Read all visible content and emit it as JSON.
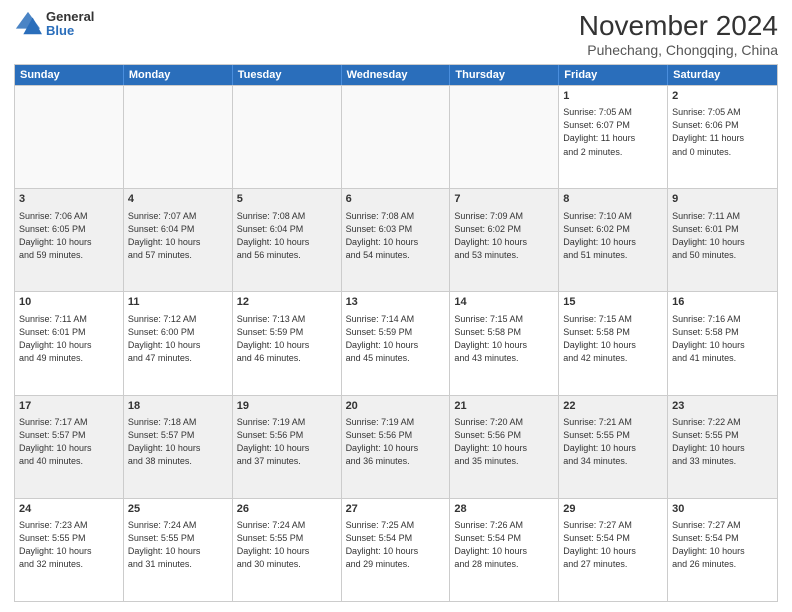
{
  "header": {
    "logo_general": "General",
    "logo_blue": "Blue",
    "month_title": "November 2024",
    "location": "Puhechang, Chongqing, China"
  },
  "weekdays": [
    "Sunday",
    "Monday",
    "Tuesday",
    "Wednesday",
    "Thursday",
    "Friday",
    "Saturday"
  ],
  "weeks": [
    [
      {
        "day": "",
        "info": "",
        "empty": true
      },
      {
        "day": "",
        "info": "",
        "empty": true
      },
      {
        "day": "",
        "info": "",
        "empty": true
      },
      {
        "day": "",
        "info": "",
        "empty": true
      },
      {
        "day": "",
        "info": "",
        "empty": true
      },
      {
        "day": "1",
        "info": "Sunrise: 7:05 AM\nSunset: 6:07 PM\nDaylight: 11 hours\nand 2 minutes.",
        "empty": false
      },
      {
        "day": "2",
        "info": "Sunrise: 7:05 AM\nSunset: 6:06 PM\nDaylight: 11 hours\nand 0 minutes.",
        "empty": false
      }
    ],
    [
      {
        "day": "3",
        "info": "Sunrise: 7:06 AM\nSunset: 6:05 PM\nDaylight: 10 hours\nand 59 minutes.",
        "empty": false
      },
      {
        "day": "4",
        "info": "Sunrise: 7:07 AM\nSunset: 6:04 PM\nDaylight: 10 hours\nand 57 minutes.",
        "empty": false
      },
      {
        "day": "5",
        "info": "Sunrise: 7:08 AM\nSunset: 6:04 PM\nDaylight: 10 hours\nand 56 minutes.",
        "empty": false
      },
      {
        "day": "6",
        "info": "Sunrise: 7:08 AM\nSunset: 6:03 PM\nDaylight: 10 hours\nand 54 minutes.",
        "empty": false
      },
      {
        "day": "7",
        "info": "Sunrise: 7:09 AM\nSunset: 6:02 PM\nDaylight: 10 hours\nand 53 minutes.",
        "empty": false
      },
      {
        "day": "8",
        "info": "Sunrise: 7:10 AM\nSunset: 6:02 PM\nDaylight: 10 hours\nand 51 minutes.",
        "empty": false
      },
      {
        "day": "9",
        "info": "Sunrise: 7:11 AM\nSunset: 6:01 PM\nDaylight: 10 hours\nand 50 minutes.",
        "empty": false
      }
    ],
    [
      {
        "day": "10",
        "info": "Sunrise: 7:11 AM\nSunset: 6:01 PM\nDaylight: 10 hours\nand 49 minutes.",
        "empty": false
      },
      {
        "day": "11",
        "info": "Sunrise: 7:12 AM\nSunset: 6:00 PM\nDaylight: 10 hours\nand 47 minutes.",
        "empty": false
      },
      {
        "day": "12",
        "info": "Sunrise: 7:13 AM\nSunset: 5:59 PM\nDaylight: 10 hours\nand 46 minutes.",
        "empty": false
      },
      {
        "day": "13",
        "info": "Sunrise: 7:14 AM\nSunset: 5:59 PM\nDaylight: 10 hours\nand 45 minutes.",
        "empty": false
      },
      {
        "day": "14",
        "info": "Sunrise: 7:15 AM\nSunset: 5:58 PM\nDaylight: 10 hours\nand 43 minutes.",
        "empty": false
      },
      {
        "day": "15",
        "info": "Sunrise: 7:15 AM\nSunset: 5:58 PM\nDaylight: 10 hours\nand 42 minutes.",
        "empty": false
      },
      {
        "day": "16",
        "info": "Sunrise: 7:16 AM\nSunset: 5:58 PM\nDaylight: 10 hours\nand 41 minutes.",
        "empty": false
      }
    ],
    [
      {
        "day": "17",
        "info": "Sunrise: 7:17 AM\nSunset: 5:57 PM\nDaylight: 10 hours\nand 40 minutes.",
        "empty": false
      },
      {
        "day": "18",
        "info": "Sunrise: 7:18 AM\nSunset: 5:57 PM\nDaylight: 10 hours\nand 38 minutes.",
        "empty": false
      },
      {
        "day": "19",
        "info": "Sunrise: 7:19 AM\nSunset: 5:56 PM\nDaylight: 10 hours\nand 37 minutes.",
        "empty": false
      },
      {
        "day": "20",
        "info": "Sunrise: 7:19 AM\nSunset: 5:56 PM\nDaylight: 10 hours\nand 36 minutes.",
        "empty": false
      },
      {
        "day": "21",
        "info": "Sunrise: 7:20 AM\nSunset: 5:56 PM\nDaylight: 10 hours\nand 35 minutes.",
        "empty": false
      },
      {
        "day": "22",
        "info": "Sunrise: 7:21 AM\nSunset: 5:55 PM\nDaylight: 10 hours\nand 34 minutes.",
        "empty": false
      },
      {
        "day": "23",
        "info": "Sunrise: 7:22 AM\nSunset: 5:55 PM\nDaylight: 10 hours\nand 33 minutes.",
        "empty": false
      }
    ],
    [
      {
        "day": "24",
        "info": "Sunrise: 7:23 AM\nSunset: 5:55 PM\nDaylight: 10 hours\nand 32 minutes.",
        "empty": false
      },
      {
        "day": "25",
        "info": "Sunrise: 7:24 AM\nSunset: 5:55 PM\nDaylight: 10 hours\nand 31 minutes.",
        "empty": false
      },
      {
        "day": "26",
        "info": "Sunrise: 7:24 AM\nSunset: 5:55 PM\nDaylight: 10 hours\nand 30 minutes.",
        "empty": false
      },
      {
        "day": "27",
        "info": "Sunrise: 7:25 AM\nSunset: 5:54 PM\nDaylight: 10 hours\nand 29 minutes.",
        "empty": false
      },
      {
        "day": "28",
        "info": "Sunrise: 7:26 AM\nSunset: 5:54 PM\nDaylight: 10 hours\nand 28 minutes.",
        "empty": false
      },
      {
        "day": "29",
        "info": "Sunrise: 7:27 AM\nSunset: 5:54 PM\nDaylight: 10 hours\nand 27 minutes.",
        "empty": false
      },
      {
        "day": "30",
        "info": "Sunrise: 7:27 AM\nSunset: 5:54 PM\nDaylight: 10 hours\nand 26 minutes.",
        "empty": false
      }
    ]
  ]
}
